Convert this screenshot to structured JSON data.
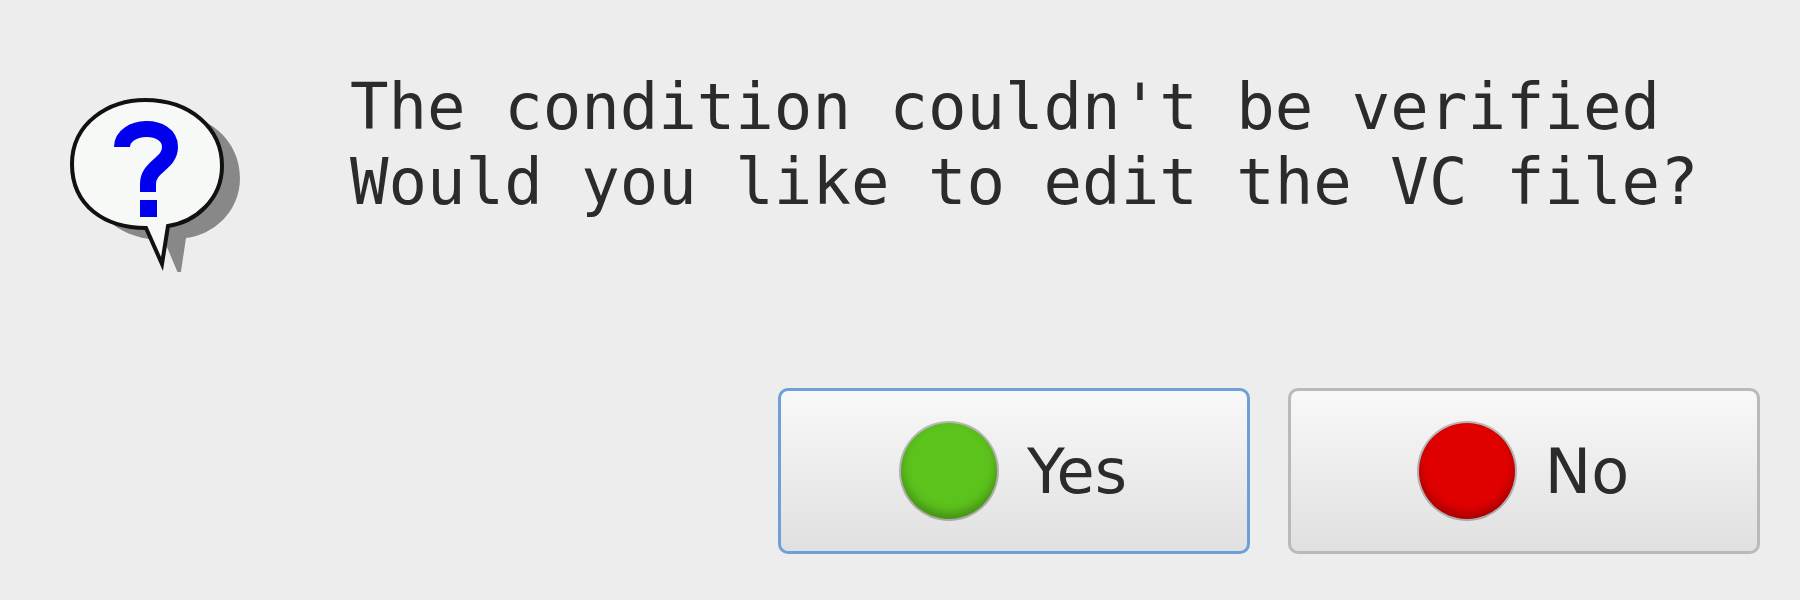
{
  "message": {
    "lines": [
      "The condition couldn't be verified",
      "Would you like to edit the VC file?"
    ]
  },
  "buttons": [
    {
      "label": "Yes",
      "color": "#5cc21c",
      "focused": true
    },
    {
      "label": "No",
      "color": "#e00000",
      "focused": false
    }
  ]
}
